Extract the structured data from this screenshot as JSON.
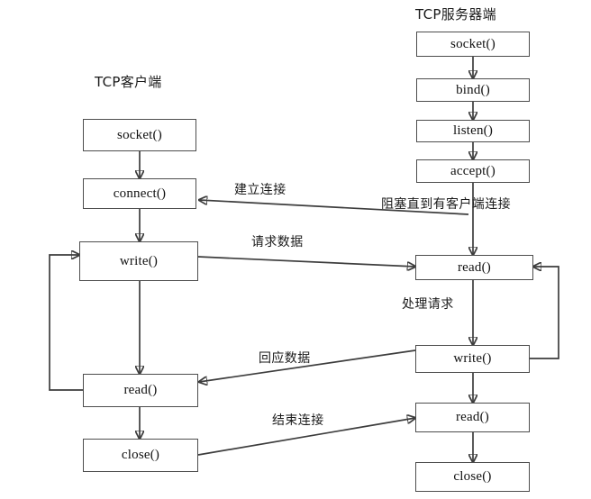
{
  "diagram": {
    "title": "TCP client-server socket flow",
    "background": "#ffffff",
    "line_color": "#3d3d3d",
    "box_border_color": "#4d4d4d",
    "text_color": "#111111",
    "columns": [
      {
        "id": "client",
        "title": "TCP客户端"
      },
      {
        "id": "server",
        "title": "TCP服务器端"
      }
    ],
    "client_nodes": [
      {
        "id": "client-socket",
        "label": "socket()"
      },
      {
        "id": "client-connect",
        "label": "connect()"
      },
      {
        "id": "client-write",
        "label": "write()"
      },
      {
        "id": "client-read",
        "label": "read()"
      },
      {
        "id": "client-close",
        "label": "close()"
      }
    ],
    "server_nodes": [
      {
        "id": "server-socket",
        "label": "socket()"
      },
      {
        "id": "server-bind",
        "label": "bind()"
      },
      {
        "id": "server-listen",
        "label": "listen()"
      },
      {
        "id": "server-accept",
        "label": "accept()"
      },
      {
        "id": "server-read",
        "label": "read()"
      },
      {
        "id": "server-write",
        "label": "write()"
      },
      {
        "id": "server-read2",
        "label": "read()"
      },
      {
        "id": "server-close",
        "label": "close()"
      }
    ],
    "edge_labels": [
      {
        "id": "establish-connection",
        "label": "建立连接"
      },
      {
        "id": "block-until-client",
        "label": "阻塞直到有客户端连接"
      },
      {
        "id": "request-data",
        "label": "请求数据"
      },
      {
        "id": "process-request",
        "label": "处理请求"
      },
      {
        "id": "response-data",
        "label": "回应数据"
      },
      {
        "id": "close-connection",
        "label": "结束连接"
      }
    ]
  }
}
